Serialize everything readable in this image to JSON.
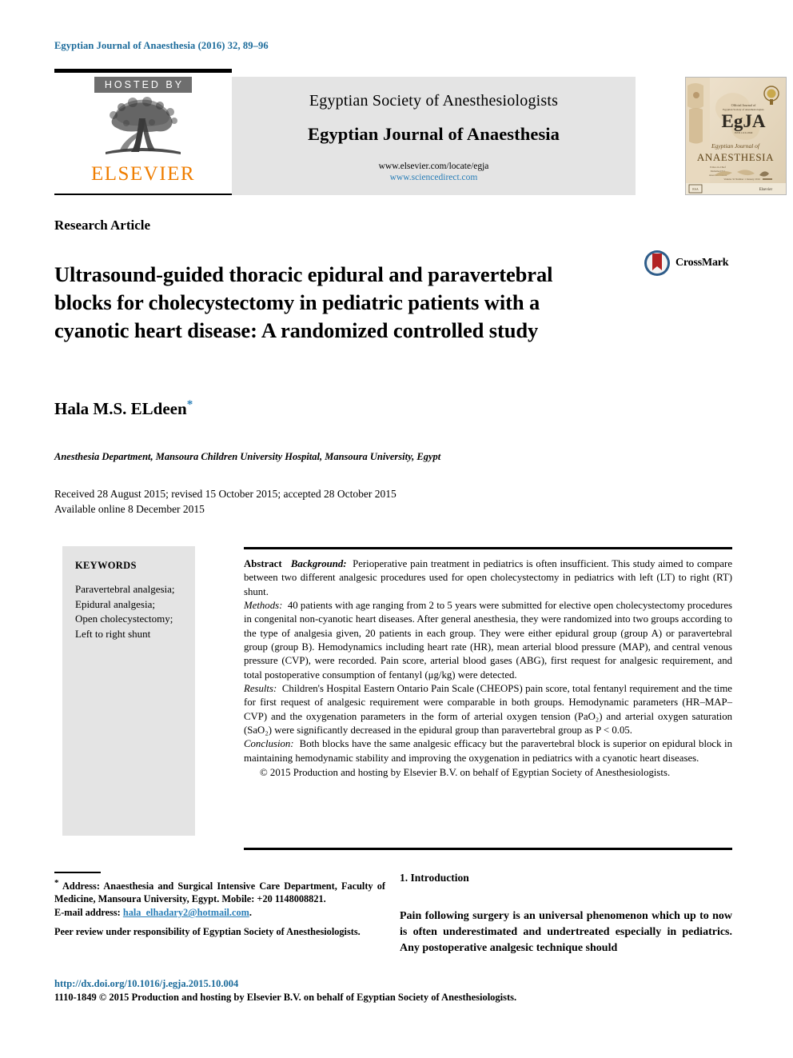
{
  "running_head": "Egyptian Journal of Anaesthesia (2016) 32, 89–96",
  "masthead": {
    "hosted_by": "HOSTED BY",
    "publisher": "ELSEVIER",
    "society": "Egyptian Society of Anesthesiologists",
    "journal_title": "Egyptian Journal of Anaesthesia",
    "url_locate": "www.elsevier.com/locate/egja",
    "url_sciencedirect": "www.sciencedirect.com",
    "cover": {
      "banner_small": "Official Journal of",
      "banner_sub": "Egyptian Society of Anesthesiologists",
      "acronym": "EgJA",
      "line1": "Egyptian Journal of",
      "line2": "ANAESTHESIA",
      "volume_note": "Volume 32 · Number 1 · January 2016",
      "publisher_mark": "Elsevier"
    }
  },
  "article": {
    "type": "Research Article",
    "title": "Ultrasound-guided thoracic epidural and paravertebral blocks for cholecystectomy in pediatric patients with a cyanotic heart disease: A randomized controlled study",
    "crossmark_label": "CrossMark",
    "author": "Hala M.S. ELdeen",
    "author_marker": "*",
    "affiliation": "Anesthesia Department, Mansoura Children University Hospital, Mansoura University, Egypt",
    "received_line": "Received 28 August 2015; revised 15 October 2015; accepted 28 October 2015",
    "available_line": "Available online 8 December 2015"
  },
  "keywords": {
    "heading": "KEYWORDS",
    "items": [
      "Paravertebral analgesia;",
      "Epidural analgesia;",
      "Open cholecystectomy;",
      "Left to right shunt"
    ]
  },
  "abstract": {
    "label": "Abstract",
    "background_label": "Background:",
    "background_text": "Perioperative pain treatment in pediatrics is often insufficient. This study aimed to compare between two different analgesic procedures used for open cholecystectomy in pediatrics with left (LT) to right (RT) shunt.",
    "methods_label": "Methods:",
    "methods_text": "40 patients with age ranging from 2 to 5 years were submitted for elective open cholecystectomy procedures in congenital non-cyanotic heart diseases. After general anesthesia, they were randomized into two groups according to the type of analgesia given, 20 patients in each group. They were either epidural group (group A) or paravertebral group (group B). Hemodynamics including heart rate (HR), mean arterial blood pressure (MAP), and central venous pressure (CVP), were recorded. Pain score, arterial blood gases (ABG), first request for analgesic requirement, and total postoperative consumption of fentanyl (μg/kg) were detected.",
    "results_label": "Results:",
    "results_text": "Children's Hospital Eastern Ontario Pain Scale (CHEOPS) pain score, total fentanyl requirement and the time for first request of analgesic requirement were comparable in both groups. Hemodynamic parameters (HR–MAP–CVP) and the oxygenation parameters in the form of arterial oxygen tension (PaO₂) and arterial oxygen saturation (SaO₂) were significantly decreased in the epidural group than paravertebral group as P < 0.05.",
    "conclusion_label": "Conclusion:",
    "conclusion_text": "Both blocks have the same analgesic efficacy but the paravertebral block is superior on epidural block in maintaining hemodynamic stability and improving the oxygenation in pediatrics with a cyanotic heart diseases.",
    "copyright": "© 2015 Production and hosting by Elsevier B.V. on behalf of Egyptian Society of Anesthesiologists."
  },
  "footnotes": {
    "address_marker": "*",
    "address": "Address: Anaesthesia and Surgical Intensive Care Department, Faculty of Medicine, Mansoura University, Egypt. Mobile: +20 1148008821.",
    "email_label": "E-mail address:",
    "email": "hala_elhadary2@hotmail.com",
    "email_trailing": ".",
    "peer_review": "Peer review under responsibility of Egyptian Society of Anesthesiologists.",
    "doi": "http://dx.doi.org/10.1016/j.egja.2015.10.004",
    "issn_line": "1110-1849 © 2015 Production and hosting by Elsevier B.V. on behalf of Egyptian Society of Anesthesiologists."
  },
  "introduction": {
    "heading": "1. Introduction",
    "paragraph": "Pain following surgery is an universal phenomenon which up to now is often underestimated and undertreated especially in pediatrics. Any postoperative analgesic technique should"
  },
  "colors": {
    "link_blue": "#2a7fb8",
    "header_blue": "#1a6a9a",
    "elsevier_orange": "#ef7d00",
    "panel_gray": "#e4e4e4",
    "hosted_gray": "#6e6e6e"
  }
}
